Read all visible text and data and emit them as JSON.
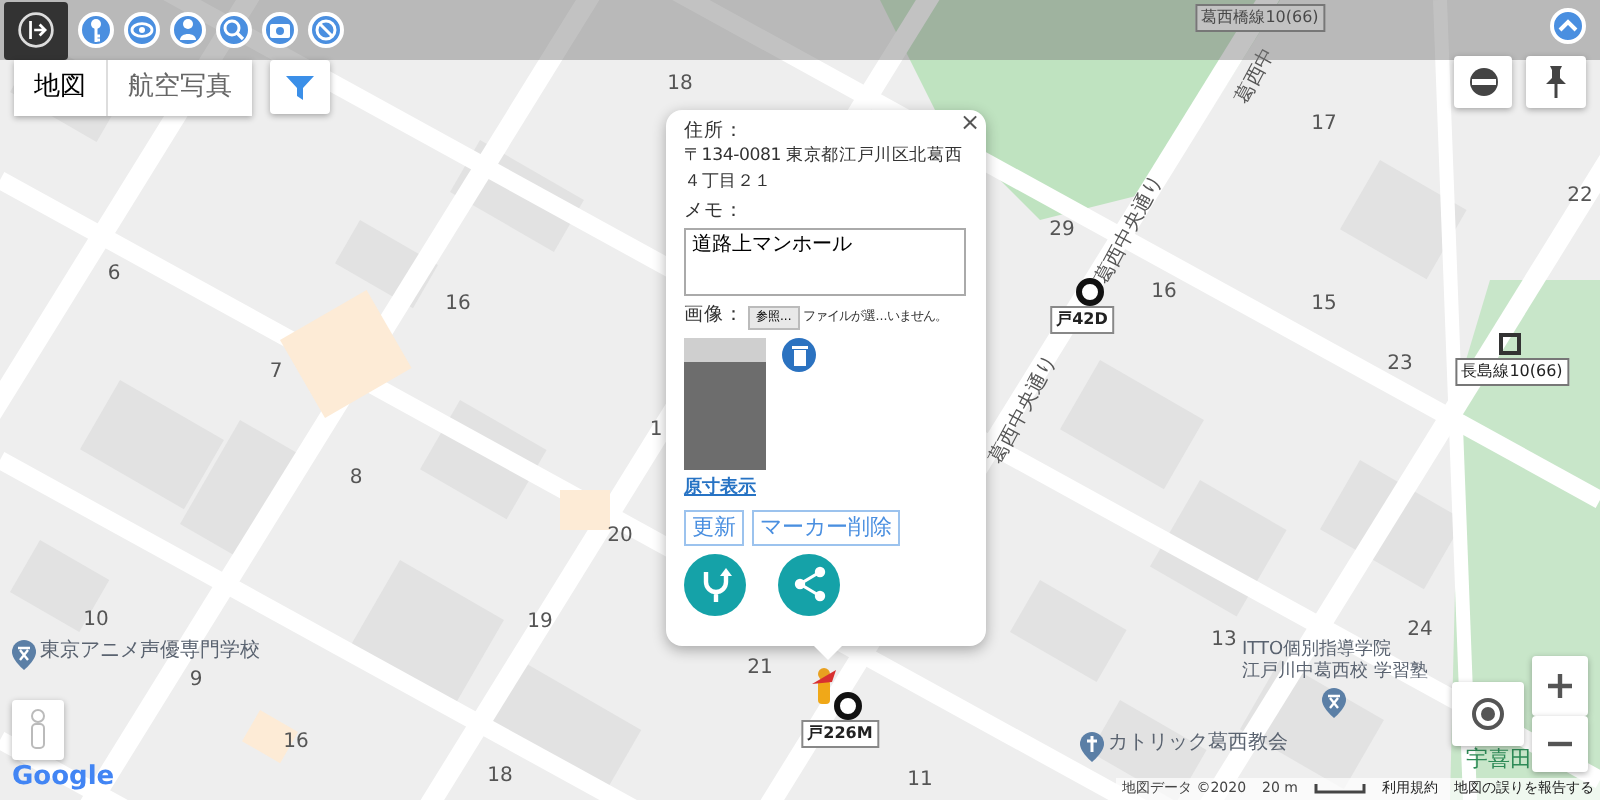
{
  "map_type_tabs": [
    {
      "label": "地図",
      "selected": true
    },
    {
      "label": "航空写真",
      "selected": false
    }
  ],
  "lot_numbers": [
    "18",
    "17",
    "22",
    "29",
    "16",
    "15",
    "23",
    "6",
    "16",
    "7",
    "1",
    "8",
    "20",
    "10",
    "9",
    "16",
    "19",
    "21",
    "18",
    "13",
    "24",
    "11"
  ],
  "street_labels": [
    "葛西中",
    "葛西中央通り",
    "葛西中央通り"
  ],
  "boundary_labels": [
    "葛西橋線10(66)",
    "長島線10(66)"
  ],
  "markers": [
    {
      "label": "戸42D"
    },
    {
      "label": "戸226M"
    }
  ],
  "places": [
    {
      "kind": "school",
      "name": "東京アニメ声優専門学校"
    },
    {
      "kind": "school",
      "name": "ITTO個別指導学院",
      "subtitle": "江戸川中葛西校 学習塾"
    },
    {
      "kind": "church",
      "name": "カトリック葛西教会"
    },
    {
      "kind": "park",
      "name": "宇喜田"
    }
  ],
  "popup": {
    "close": "×",
    "address_label": "住所：",
    "address": "〒134-0081 東京都江戸川区北葛西４丁目２１",
    "memo_label": "メモ：",
    "memo": "道路上マンホール",
    "image_label": "画像：",
    "file_button": "参照...",
    "file_status": "ファイルが選...いません。",
    "original_size_link": "原寸表示",
    "buttons": [
      "更新",
      "マーカー削除"
    ]
  },
  "attribution": {
    "logo": "Google",
    "map_data": "地図データ ©2020",
    "scale": "20 m",
    "terms": "利用規約",
    "report": "地図の誤りを報告する"
  }
}
